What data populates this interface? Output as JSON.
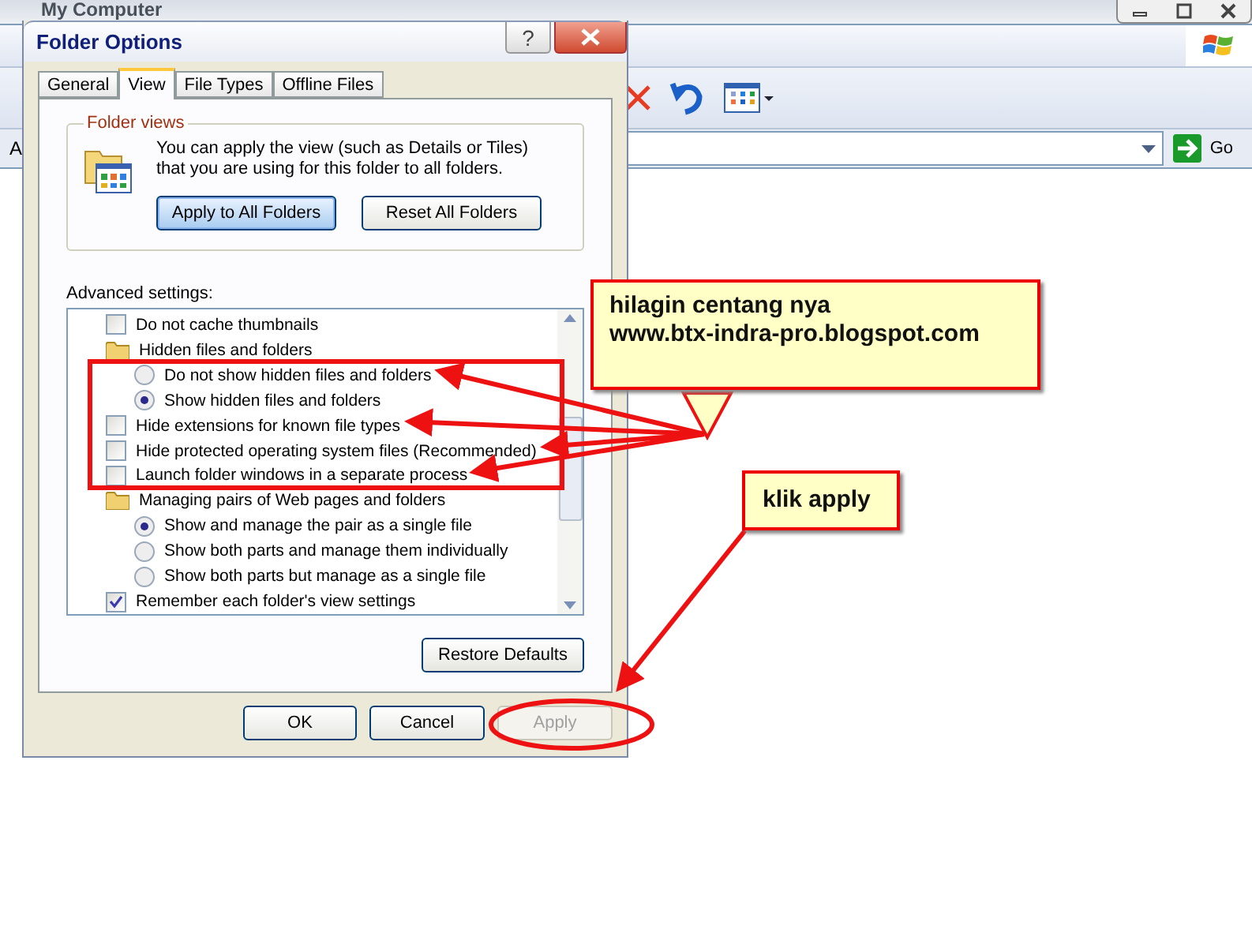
{
  "background_window": {
    "title": "My Computer",
    "address_label": "A",
    "go_button": "Go"
  },
  "dialog": {
    "title": "Folder Options",
    "help_button": "?",
    "tabs": [
      {
        "label": "General",
        "selected": false
      },
      {
        "label": "View",
        "selected": true
      },
      {
        "label": "File Types",
        "selected": false
      },
      {
        "label": "Offline Files",
        "selected": false
      }
    ],
    "folder_views": {
      "legend": "Folder views",
      "description": "You can apply the view (such as Details or Tiles) that you are using for this folder to all folders.",
      "buttons": [
        {
          "label": "Apply to All Folders",
          "focused": true
        },
        {
          "label": "Reset All Folders",
          "focused": false
        }
      ]
    },
    "advanced_label": "Advanced settings:",
    "settings": [
      {
        "kind": "checkbox",
        "label": "Do not cache thumbnails",
        "checked": false
      },
      {
        "kind": "folder",
        "label": "Hidden files and folders",
        "children": [
          {
            "kind": "radio",
            "label": "Do not show hidden files and folders",
            "selected": false
          },
          {
            "kind": "radio",
            "label": "Show hidden files and folders",
            "selected": true
          }
        ]
      },
      {
        "kind": "checkbox",
        "label": "Hide extensions for known file types",
        "checked": false
      },
      {
        "kind": "checkbox",
        "label": "Hide protected operating system files (Recommended)",
        "checked": false
      },
      {
        "kind": "checkbox",
        "label": "Launch folder windows in a separate process",
        "checked": false
      },
      {
        "kind": "folder",
        "label": "Managing pairs of Web pages and folders",
        "children": [
          {
            "kind": "radio",
            "label": "Show and manage the pair as a single file",
            "selected": true
          },
          {
            "kind": "radio",
            "label": "Show both parts and manage them individually",
            "selected": false
          },
          {
            "kind": "radio",
            "label": "Show both parts but manage as a single file",
            "selected": false
          }
        ]
      },
      {
        "kind": "checkbox",
        "label": "Remember each folder's view settings",
        "checked": true
      }
    ],
    "restore_button": "Restore Defaults",
    "buttons": [
      {
        "label": "OK",
        "disabled": false
      },
      {
        "label": "Cancel",
        "disabled": false
      },
      {
        "label": "Apply",
        "disabled": true
      }
    ]
  },
  "callouts": [
    {
      "lines": [
        "hilagin centang nya",
        "www.btx-indra-pro.blogspot.com"
      ]
    },
    {
      "lines": [
        "klik apply"
      ]
    }
  ]
}
